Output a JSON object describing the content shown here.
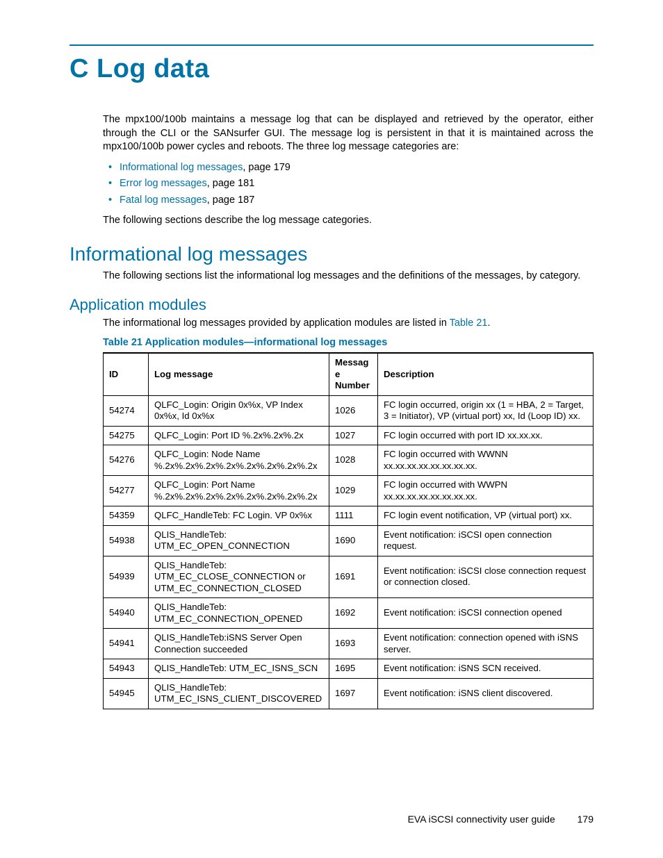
{
  "heading_main": "C Log data",
  "intro_para": "The mpx100/100b maintains a message log that can be displayed and retrieved by the operator, either through the CLI or the SANsurfer GUI. The message log is persistent in that it is maintained across the mpx100/100b power cycles and reboots. The three log message categories are:",
  "bullets": [
    {
      "link": "Informational log messages",
      "rest": ", page 179"
    },
    {
      "link": "Error log messages",
      "rest": ", page 181"
    },
    {
      "link": "Fatal log messages",
      "rest": ", page 187"
    }
  ],
  "post_bullets": "The following sections describe the log message categories.",
  "h2_info": "Informational log messages",
  "info_para": "The following sections list the informational log messages and the definitions of the messages, by category.",
  "h3_app": "Application modules",
  "app_para_pre": "The informational log messages provided by application modules are listed in ",
  "app_para_link": "Table 21",
  "app_para_post": ".",
  "table_caption": "Table 21 Application modules—informational log messages",
  "table_headers": {
    "id": "ID",
    "log": "Log message",
    "num": "Message Number",
    "desc": "Description"
  },
  "rows": [
    {
      "id": "54274",
      "log": "QLFC_Login: Origin 0x%x, VP Index 0x%x, Id 0x%x",
      "num": "1026",
      "desc": "FC login occurred, origin xx (1 = HBA, 2 = Target, 3 = Initiator), VP (virtual port) xx, Id (Loop ID) xx."
    },
    {
      "id": "54275",
      "log": "QLFC_Login: Port ID %.2x%.2x%.2x",
      "num": "1027",
      "desc": "FC login occurred with port ID xx.xx.xx."
    },
    {
      "id": "54276",
      "log": "QLFC_Login: Node Name %.2x%.2x%.2x%.2x%.2x%.2x%.2x%.2x",
      "num": "1028",
      "desc": "FC login occurred with WWNN xx.xx.xx.xx.xx.xx.xx.xx."
    },
    {
      "id": "54277",
      "log": "QLFC_Login: Port Name %.2x%.2x%.2x%.2x%.2x%.2x%.2x%.2x",
      "num": "1029",
      "desc": "FC login occurred with WWPN xx.xx.xx.xx.xx.xx.xx.xx."
    },
    {
      "id": "54359",
      "log": "QLFC_HandleTeb: FC Login. VP 0x%x",
      "num": "1111",
      "desc": "FC login event notification, VP (virtual port) xx."
    },
    {
      "id": "54938",
      "log": "QLIS_HandleTeb: UTM_EC_OPEN_CONNECTION",
      "num": "1690",
      "desc": "Event notification: iSCSI open connection request."
    },
    {
      "id": "54939",
      "log": "QLIS_HandleTeb: UTM_EC_CLOSE_CONNECTION or UTM_EC_CONNECTION_CLOSED",
      "num": "1691",
      "desc": "Event notification: iSCSI close connection request or connection closed."
    },
    {
      "id": "54940",
      "log": "QLIS_HandleTeb: UTM_EC_CONNECTION_OPENED",
      "num": "1692",
      "desc": "Event notification: iSCSI connection opened"
    },
    {
      "id": "54941",
      "log": "QLIS_HandleTeb:iSNS Server Open Connection succeeded",
      "num": "1693",
      "desc": "Event notification: connection opened with iSNS server."
    },
    {
      "id": "54943",
      "log": "QLIS_HandleTeb: UTM_EC_ISNS_SCN",
      "num": "1695",
      "desc": "Event notification: iSNS SCN received."
    },
    {
      "id": "54945",
      "log": "QLIS_HandleTeb: UTM_EC_ISNS_CLIENT_DISCOVERED",
      "num": "1697",
      "desc": "Event notification: iSNS client discovered."
    }
  ],
  "footer_title": "EVA iSCSI connectivity user guide",
  "footer_page": "179"
}
